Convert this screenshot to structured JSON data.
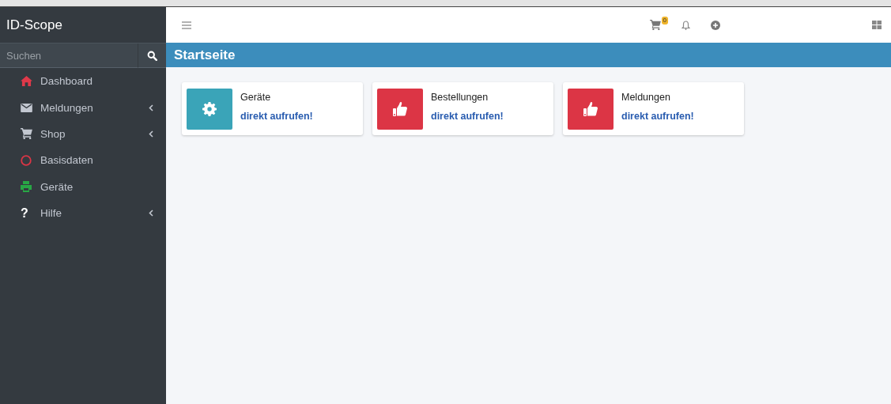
{
  "brand": "ID-Scope",
  "search": {
    "placeholder": "Suchen"
  },
  "sidebar": {
    "items": [
      {
        "label": "Dashboard",
        "kind": "home",
        "color": "#e0394a",
        "has_submenu": false
      },
      {
        "label": "Meldungen",
        "kind": "envelope",
        "color": "#c2c7d0",
        "has_submenu": true
      },
      {
        "label": "Shop",
        "kind": "cart",
        "color": "#c2c7d0",
        "has_submenu": true
      },
      {
        "label": "Basisdaten",
        "kind": "circle",
        "color": "#dc3545",
        "has_submenu": false
      },
      {
        "label": "Geräte",
        "kind": "printer",
        "color": "#28a745",
        "has_submenu": false
      },
      {
        "label": "Hilfe",
        "kind": "symbol",
        "symbol": "?",
        "color": "#ffffff",
        "has_submenu": true
      }
    ]
  },
  "navbar": {
    "cart_count": "0"
  },
  "page_title": "Startseite",
  "cards": [
    {
      "title": "Geräte",
      "link": "direkt aufrufen!",
      "kind": "gear",
      "color": "#3aa4b8"
    },
    {
      "title": "Bestellungen",
      "link": "direkt aufrufen!",
      "kind": "thumbs-up",
      "color": "#dc3545"
    },
    {
      "title": "Meldungen",
      "link": "direkt aufrufen!",
      "kind": "thumbs-up",
      "color": "#dc3545"
    }
  ]
}
